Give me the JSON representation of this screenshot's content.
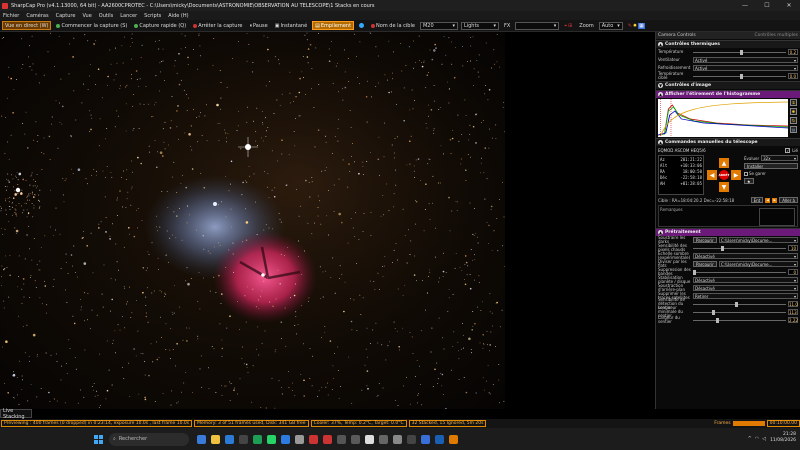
{
  "window": {
    "title": "SharpCap Pro (v4.1.13000, 64 bit) - AA2600CPROTEC - C:\\Users\\micky\\Documents\\ASTRONOMIE\\OBSERVATION AU TELESCOPE\\1 Stacks en cours"
  },
  "menu": [
    "Fichier",
    "Caméras",
    "Capture",
    "Vue",
    "Outils",
    "Lancer",
    "Scripts",
    "Aide (H)"
  ],
  "toolbar": {
    "live_view": "Vue en direct (W)",
    "start_capture": "Commencer la capture (S)",
    "quick_capture": "Capture rapide (Q)",
    "stop_capture": "Arrêter la capture",
    "pause": "Pause",
    "snapshot": "Instantané",
    "stacking": "Empilement",
    "target_name_label": "Nom de la cible",
    "target_name_value": "M20",
    "frame_type": "Lights",
    "fx_label": "FX",
    "zoom_label": "Zoom",
    "zoom_value": "Auto"
  },
  "right_panel": {
    "header": "Camera Controls",
    "header_option": "Contrôles multiples",
    "thermal": {
      "title": "Contrôles thermiques",
      "temperature_label": "Température",
      "temperature_value": "0.2",
      "fan_label": "Ventilateur",
      "fan_value": "Activé",
      "cooling_label": "Refroidissement",
      "cooling_value": "Activé",
      "target_temp_label": "Température cible",
      "target_temp_value": "0.0"
    },
    "image_controls_title": "Contrôles d'image",
    "histogram_title": "Afficher l'étirement de l'histogramme",
    "telescope": {
      "title": "Commandes manuelles du télescope",
      "mount": "EQMOD ASCOM HEQ5/6",
      "az_label": "Az",
      "az_value": "201:21:22",
      "alt_label": "Alt",
      "alt_value": "+10:33:06",
      "ra_label": "RA",
      "ra_value": "18:00:50",
      "dec_label": "Déc",
      "dec_value": "-22:58:18",
      "ah_label": "AH",
      "ah_value": "+01:28:05",
      "track_label": "Lié",
      "rate_label": "Évaluer",
      "rate_value": "32x",
      "install_button": "Installer",
      "park_label": "Se garer",
      "stop_label": "ARRÊT",
      "target_line": "Cible : RA=18:04:20.2 Dec=-22:58:18",
      "go_button": "Aller à",
      "remarks_label": "Remarques"
    },
    "preprocessing": {
      "title": "Prétraitement",
      "rows": [
        {
          "label": "Soustraire les darks",
          "button": "Parcourir",
          "value": "C:\\Users\\micky\\Docume..."
        },
        {
          "label": "Sensibilité des pixels chauds",
          "value": "10"
        },
        {
          "label": "Échelle sombre (expérimentale)",
          "value": "Désactivé"
        },
        {
          "label": "Diviser par les flats",
          "button": "Parcourir",
          "value": "C:\\Users\\micky\\Docume..."
        },
        {
          "label": "Suppression des bandes",
          "value": "0"
        },
        {
          "label": "Stabilisation planète / disque",
          "value": "Désactivé"
        },
        {
          "label": "Soustraction d'arrière-plan",
          "value": "Désactivé"
        },
        {
          "label": "Supprimer les traces satellites",
          "value": "Retirer"
        },
        {
          "label": "Sensibilité de détection du sentier",
          "value": "11.0"
        },
        {
          "label": "Longueur minimale du sentier",
          "value": "113"
        },
        {
          "label": "Largeur du sentier",
          "value": "2.22"
        }
      ]
    }
  },
  "live_tab": "Live Stacking",
  "status": {
    "preview": "Previewing : 400 frames (0 dropped) in 0:23:14, exposure 10.0s , last frame 10.0s",
    "memory": "Memory: 3 of 51 frames used, Disk: 341 GB free",
    "cooler": "Cooler: 37%, Temp: 0.2°C, Target: 0.0°C",
    "stack": "32 Stacked, 15 Ignored, 5m 20s",
    "frames_label": "Frames",
    "time": "00:10:00.00"
  },
  "taskbar": {
    "search_placeholder": "Rechercher",
    "time": "21:28",
    "date": "11/08/2026"
  },
  "colors": {
    "accent": "#e07a00",
    "panel_section": "#6b1a7a",
    "nebula_pink": "#e0306a",
    "nebula_blue": "#7a8fc0"
  }
}
